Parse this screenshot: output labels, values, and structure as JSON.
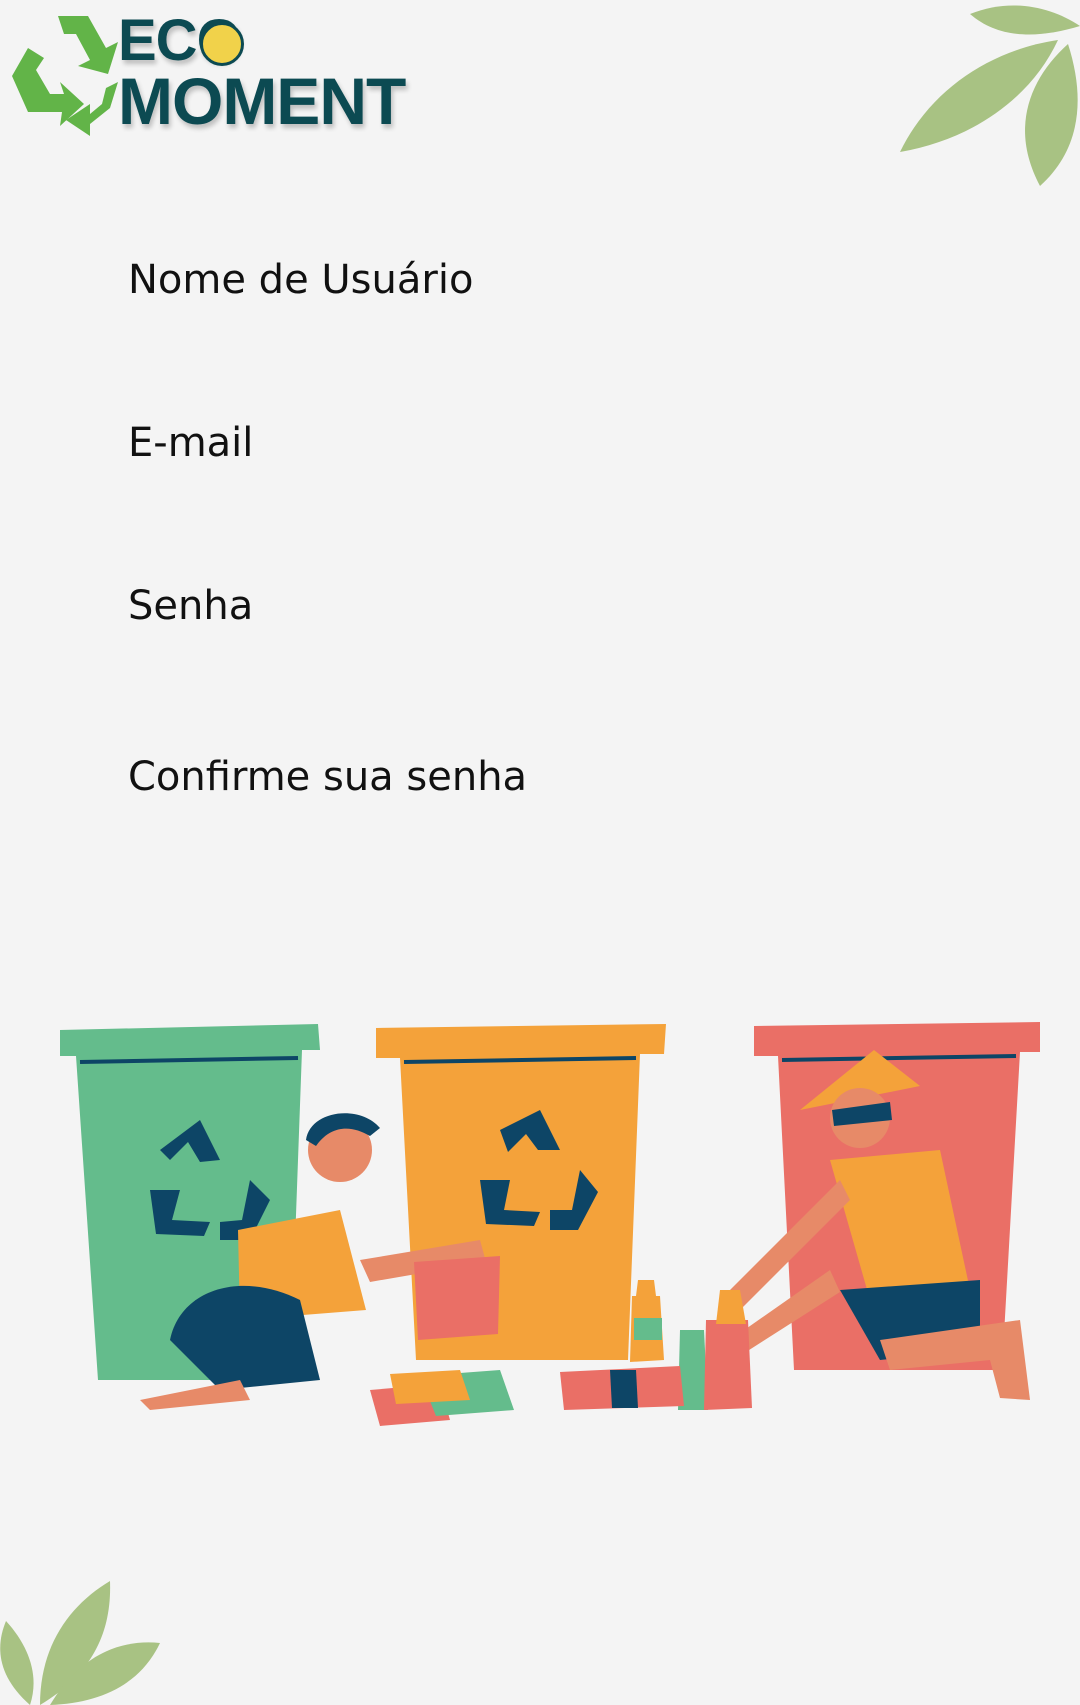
{
  "brand": {
    "line1": "ECO",
    "line2": "MOMENT"
  },
  "form": {
    "username_label": "Nome de Usuário",
    "email_label": "E-mail",
    "password_label": "Senha",
    "confirm_label": "Confirme sua senha"
  },
  "colors": {
    "background": "#f4f4f4",
    "brand_text": "#0c4a52",
    "recycle_green": "#62b448",
    "leaf_green": "#a8c283",
    "bin_green": "#64bc8c",
    "bin_orange": "#f4a23a",
    "bin_red": "#ea6f66",
    "navy": "#0d4566"
  }
}
